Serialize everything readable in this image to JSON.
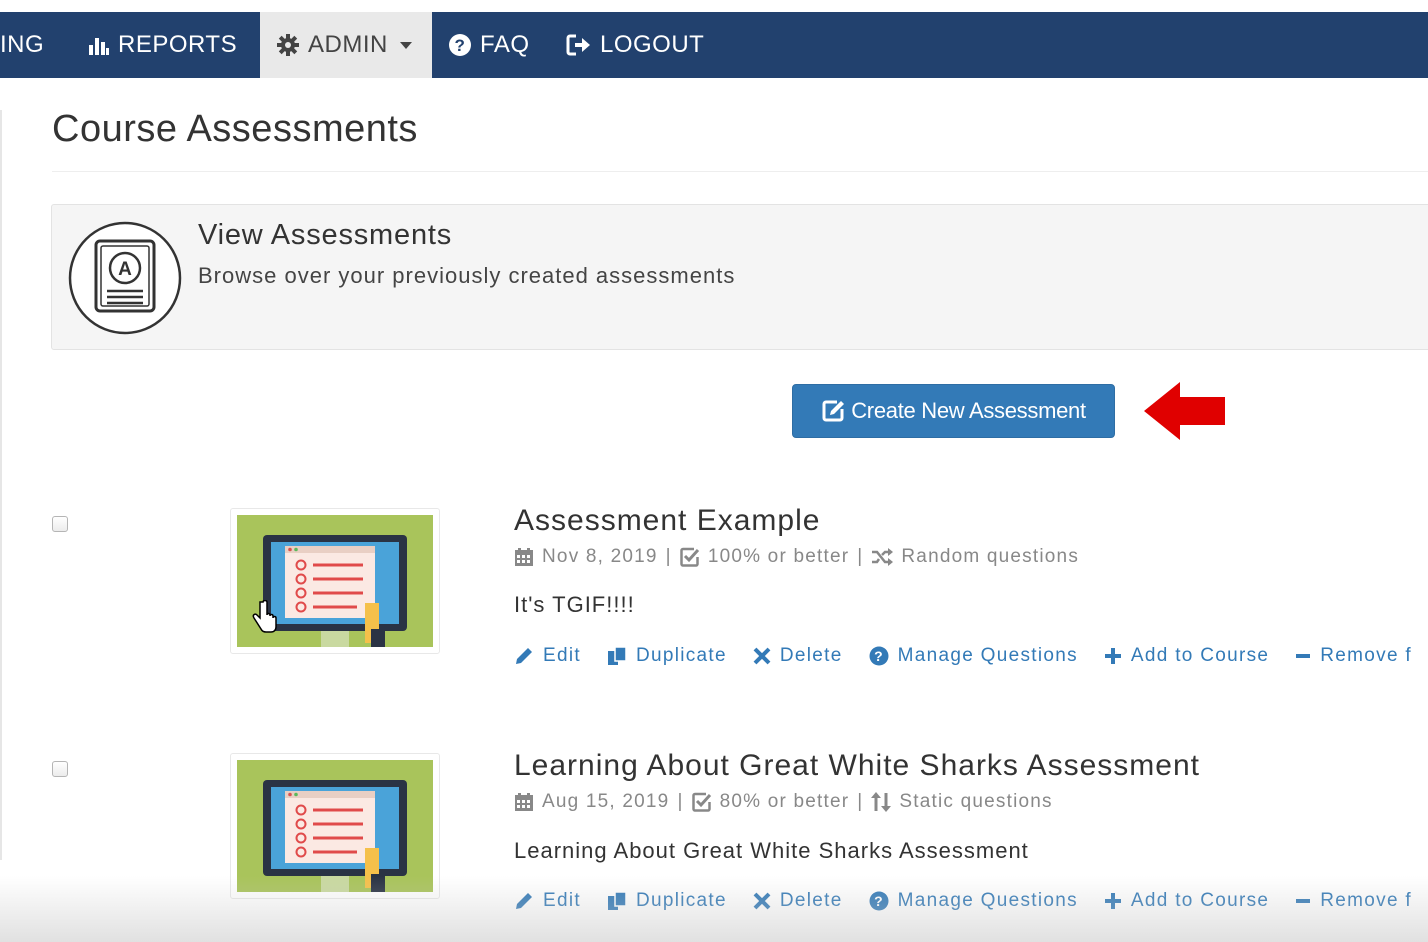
{
  "nav": {
    "items": [
      {
        "label": "ING",
        "icon": "none"
      },
      {
        "label": "REPORTS",
        "icon": "bar-chart-icon"
      },
      {
        "label": "ADMIN",
        "icon": "gear-icon",
        "active": true
      },
      {
        "label": "FAQ",
        "icon": "question-circle-icon"
      },
      {
        "label": "LOGOUT",
        "icon": "sign-out-icon"
      }
    ]
  },
  "page": {
    "title": "Course Assessments"
  },
  "panel": {
    "title": "View Assessments",
    "subtitle": "Browse over your previously created assessments",
    "icon": "assessment-badge-icon"
  },
  "create_button": {
    "label": "Create New Assessment",
    "icon": "edit-square-icon"
  },
  "assessments": [
    {
      "title": "Assessment Example",
      "date": "Nov 8, 2019",
      "passing": "100% or better",
      "question_mode": "Random questions",
      "question_mode_icon": "random-icon",
      "description": "It's TGIF!!!!"
    },
    {
      "title": "Learning About Great White Sharks Assessment",
      "date": "Aug 15, 2019",
      "passing": "80% or better",
      "question_mode": "Static questions",
      "question_mode_icon": "sort-icon",
      "description": "Learning About Great White Sharks Assessment"
    }
  ],
  "actions": {
    "edit": "Edit",
    "duplicate": "Duplicate",
    "delete": "Delete",
    "manage": "Manage Questions",
    "add": "Add to Course",
    "remove": "Remove f"
  },
  "colors": {
    "navbar": "#22416e",
    "primary": "#337ab7",
    "arrow": "#e00000",
    "thumb_bg": "#a9c45b"
  }
}
